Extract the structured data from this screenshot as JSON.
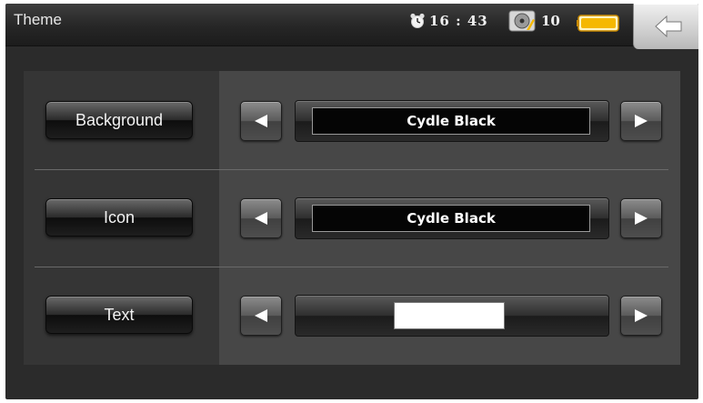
{
  "header": {
    "title": "Theme",
    "time": "16 : 43",
    "disc_count": "10",
    "icons": {
      "clock": "alarm-clock-icon",
      "disc": "disc-icon",
      "battery": "battery-icon",
      "back": "back-arrow-icon"
    },
    "battery_color": "#f5b800"
  },
  "settings": [
    {
      "label": "Background",
      "value": "Cydle Black"
    },
    {
      "label": "Icon",
      "value": "Cydle Black"
    },
    {
      "label": "Text",
      "value": "",
      "swatch_color": "#ffffff"
    }
  ]
}
